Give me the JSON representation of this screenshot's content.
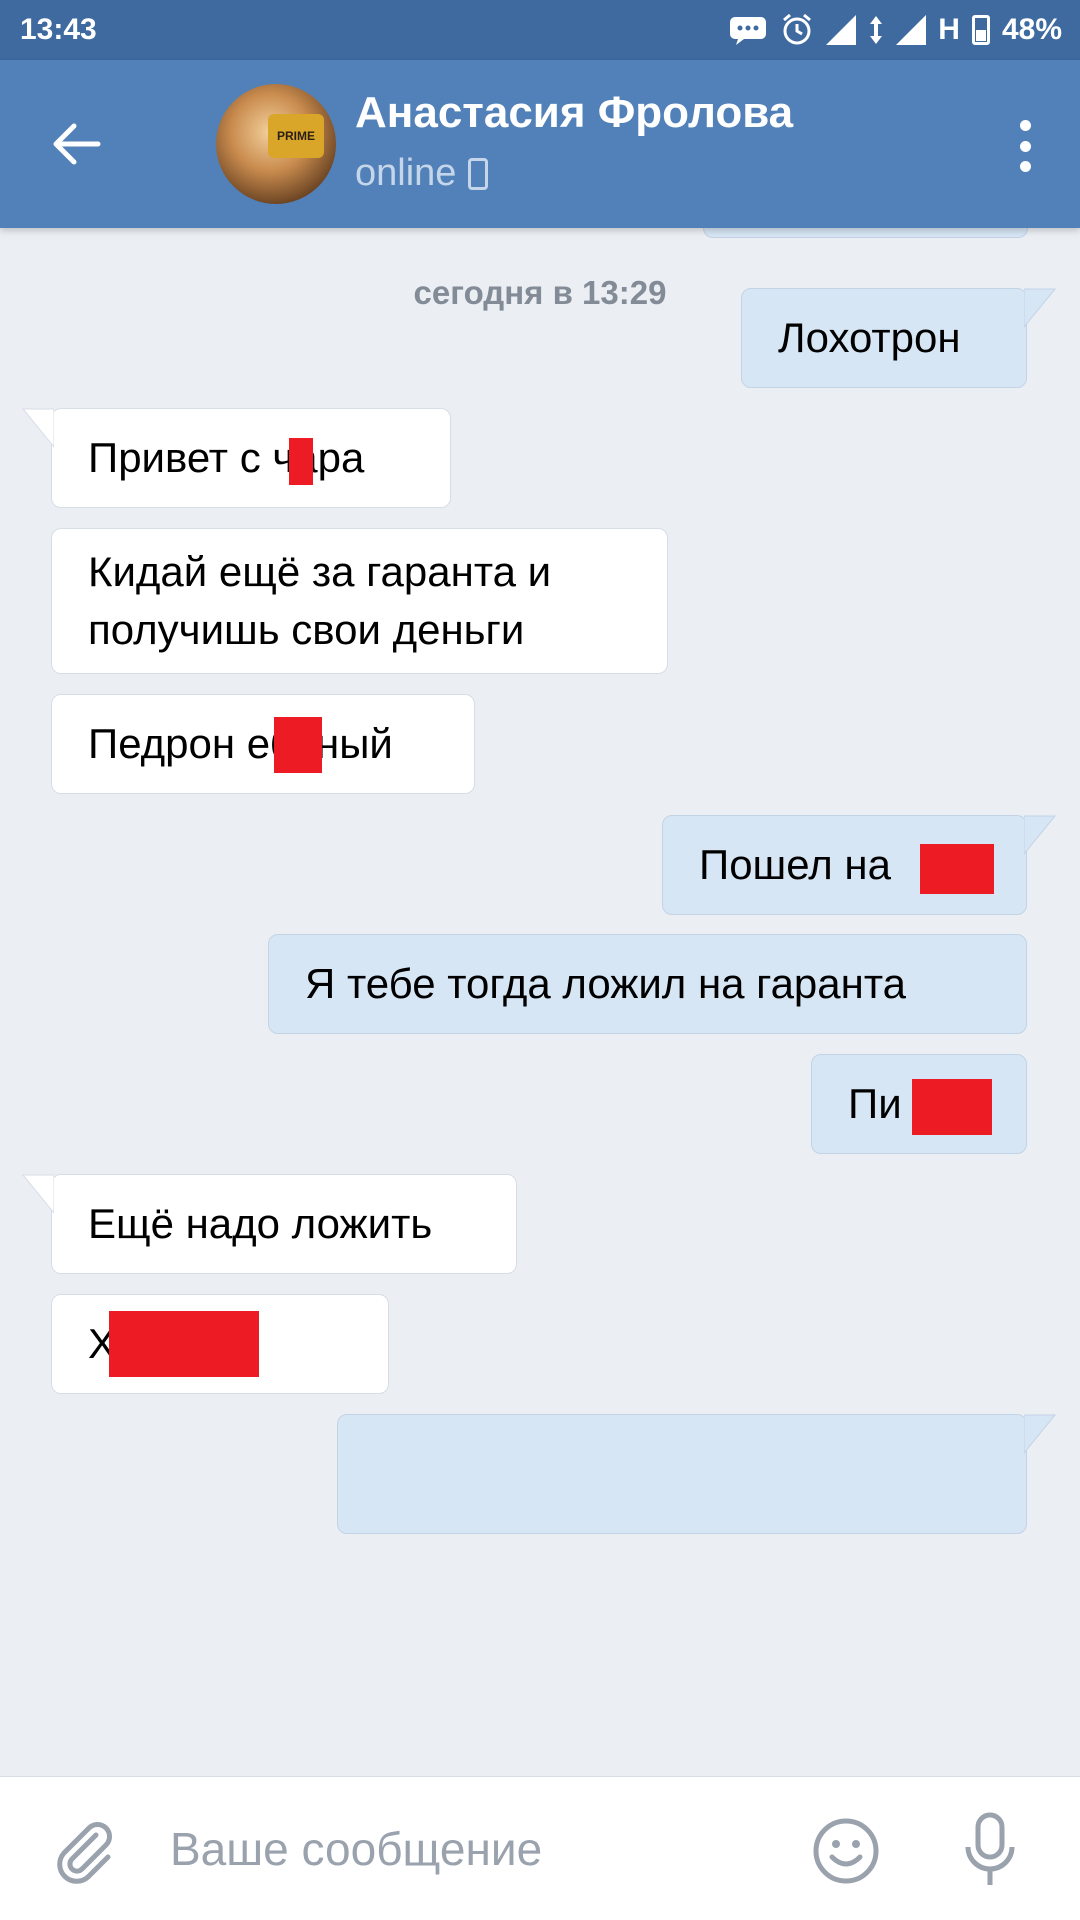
{
  "status_bar": {
    "time": "13:43",
    "network": "H",
    "battery": "48%",
    "icons": [
      "message-icon",
      "alarm-icon",
      "signal-icon",
      "data-arrows-icon",
      "signal-icon",
      "battery-icon"
    ]
  },
  "header": {
    "contact_name": "Анастасия Фролова",
    "status": "online",
    "avatar_text": "PRIME"
  },
  "chat": {
    "date_separator": "сегодня в 13:29",
    "messages": [
      {
        "direction": "out",
        "text": "Лохотрон"
      },
      {
        "direction": "in",
        "text": "Привет с чара"
      },
      {
        "direction": "in",
        "text": "Кидай ещё за гаранта и\nполучишь свои деньги"
      },
      {
        "direction": "in",
        "text": "Педрон ебаный"
      },
      {
        "direction": "out",
        "text": "Пошел на"
      },
      {
        "direction": "out",
        "text": "Я тебе тогда ложил на гаранта"
      },
      {
        "direction": "out",
        "text": "Пи"
      },
      {
        "direction": "in",
        "text": "Ещё надо ложить"
      },
      {
        "direction": "in",
        "text": "Х ый"
      }
    ]
  },
  "input": {
    "placeholder": "Ваше сообщение",
    "value": ""
  },
  "colors": {
    "header": "#5181b8",
    "status_bar": "#3e6aa0",
    "background": "#ebeff4",
    "outgoing_bubble": "#d7e6f5",
    "incoming_bubble": "#ffffff",
    "redaction": "#ed1c24"
  }
}
